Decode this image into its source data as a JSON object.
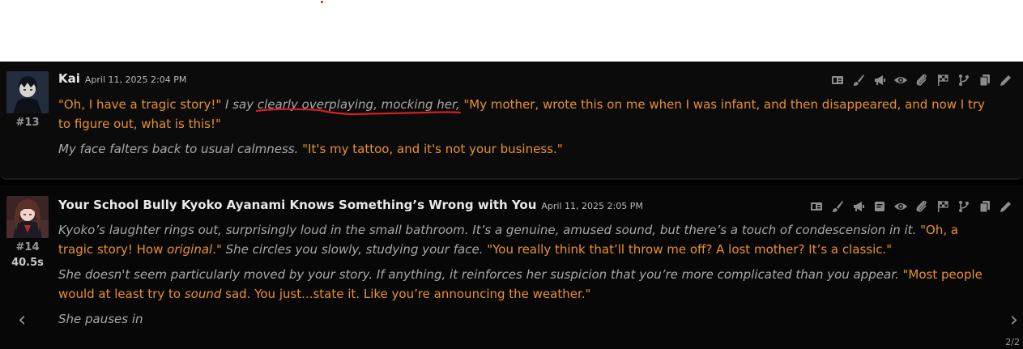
{
  "messages": [
    {
      "name": "Kai",
      "timestamp": "April 11, 2025 2:04 PM",
      "id": "#13",
      "paragraphs": [
        {
          "q1": "\"Oh, I have a tragic story!\"",
          "i1": " I say clearly overplaying, mocking her, ",
          "q2": "\"My mother, wrote this on me when I was infant, and then disappeared, and now I try to figure out, what is this!\""
        },
        {
          "i1": "My face falters back to usual calmness. ",
          "q1": "\"It's my tattoo, and it's not your business.\""
        }
      ]
    },
    {
      "name": "Your School Bully Kyoko Ayanami Knows Something’s Wrong with You",
      "timestamp": "April 11, 2025 2:05 PM",
      "id": "#14",
      "timer": "40.5s",
      "p1_i1": "Kyoko’s laughter rings out, surprisingly loud in the small bathroom. It’s a genuine, amused sound, but there’s a touch of condescension in it. ",
      "p1_q1": "\"Oh, a tragic story! How ",
      "p1_qi": "original",
      "p1_q2": ".\"",
      "p1_i2": " She circles you slowly, studying your face. ",
      "p1_q3": "\"You really think that’ll throw me off? A lost mother? It’s a classic.\"",
      "p2_i1": "She doesn't seem particularly moved by your story. If anything, it reinforces her suspicion that you’re more complicated than you appear. ",
      "p2_q1": "\"Most people would at least try to ",
      "p2_qi": "sound",
      "p2_q2": " sad. You just...state it. Like you’re announcing the weather.\"",
      "p3_i1": "She pauses in",
      "swipe_counter": "2/2"
    }
  ],
  "icons": [
    "translate-icon",
    "paint-brush-icon",
    "megaphone-icon",
    "eye-icon",
    "paperclip-icon",
    "flag-checkered-icon",
    "branch-icon",
    "copy-icon",
    "pencil-icon"
  ],
  "icons_msg2": [
    "translate-icon",
    "paint-brush-icon",
    "megaphone-icon",
    "note-icon",
    "eye-icon",
    "paperclip-icon",
    "flag-checkered-icon",
    "branch-icon",
    "copy-icon",
    "pencil-icon"
  ],
  "colors": {
    "quote": "#e8912f",
    "narration": "#a6a6a6",
    "background": "#000000",
    "annotation": "#d21f1f"
  }
}
